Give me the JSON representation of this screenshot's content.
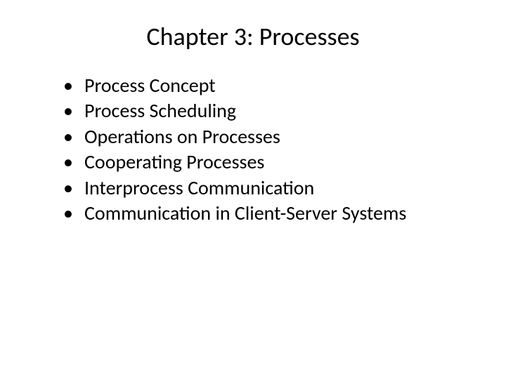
{
  "title": "Chapter 3:  Processes",
  "bullets": {
    "0": "Process Concept",
    "1": "Process Scheduling",
    "2": "Operations on Processes",
    "3": "Cooperating Processes",
    "4": "Interprocess Communication",
    "5": "Communication in Client-Server Systems"
  }
}
